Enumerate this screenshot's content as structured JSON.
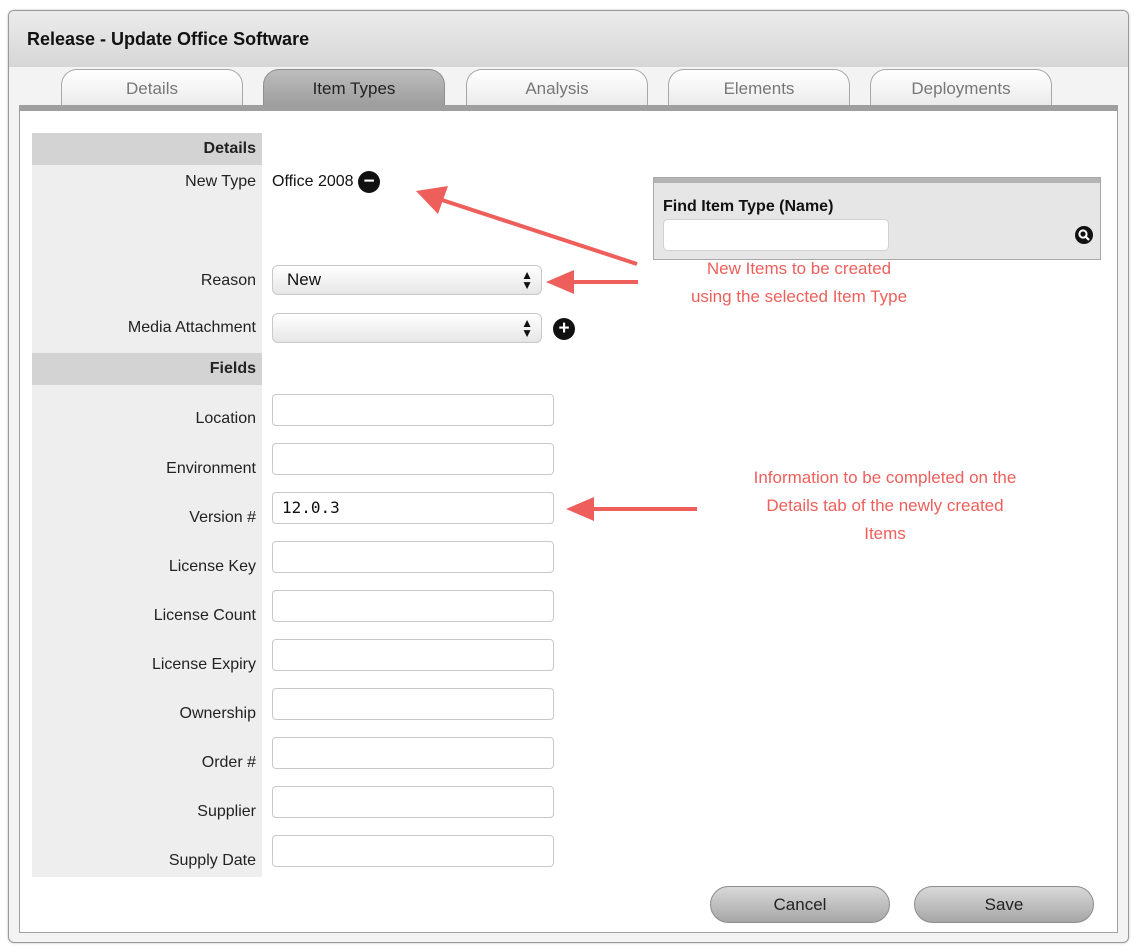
{
  "window": {
    "title": "Release - Update Office Software"
  },
  "tabs": [
    {
      "label": "Details",
      "active": false
    },
    {
      "label": "Item Types",
      "active": true
    },
    {
      "label": "Analysis",
      "active": false
    },
    {
      "label": "Elements",
      "active": false
    },
    {
      "label": "Deployments",
      "active": false
    }
  ],
  "form": {
    "details_header": "Details",
    "new_type": {
      "label": "New Type",
      "value": "Office 2008",
      "icon": "minus-circle-icon"
    },
    "reason": {
      "label": "Reason",
      "value": "New"
    },
    "media_attachment": {
      "label": "Media Attachment",
      "value": "",
      "icon": "plus-circle-icon"
    },
    "fields_header": "Fields",
    "fields": [
      {
        "label": "Location",
        "value": ""
      },
      {
        "label": "Environment",
        "value": ""
      },
      {
        "label": "Version #",
        "value": "12.0.3"
      },
      {
        "label": "License Key",
        "value": ""
      },
      {
        "label": "License Count",
        "value": ""
      },
      {
        "label": "License Expiry",
        "value": ""
      },
      {
        "label": "Ownership",
        "value": ""
      },
      {
        "label": "Order #",
        "value": ""
      },
      {
        "label": "Supplier",
        "value": ""
      },
      {
        "label": "Supply Date",
        "value": ""
      }
    ]
  },
  "find": {
    "label": "Find Item Type (Name)",
    "value": "",
    "icon": "search-icon"
  },
  "annotations": {
    "note1": [
      "New Items to be created",
      "using the selected Item Type"
    ],
    "note2": [
      "Information to be completed on the",
      "Details tab of the newly created",
      "Items"
    ],
    "color": "#ee5f5b"
  },
  "buttons": {
    "cancel": "Cancel",
    "save": "Save"
  }
}
